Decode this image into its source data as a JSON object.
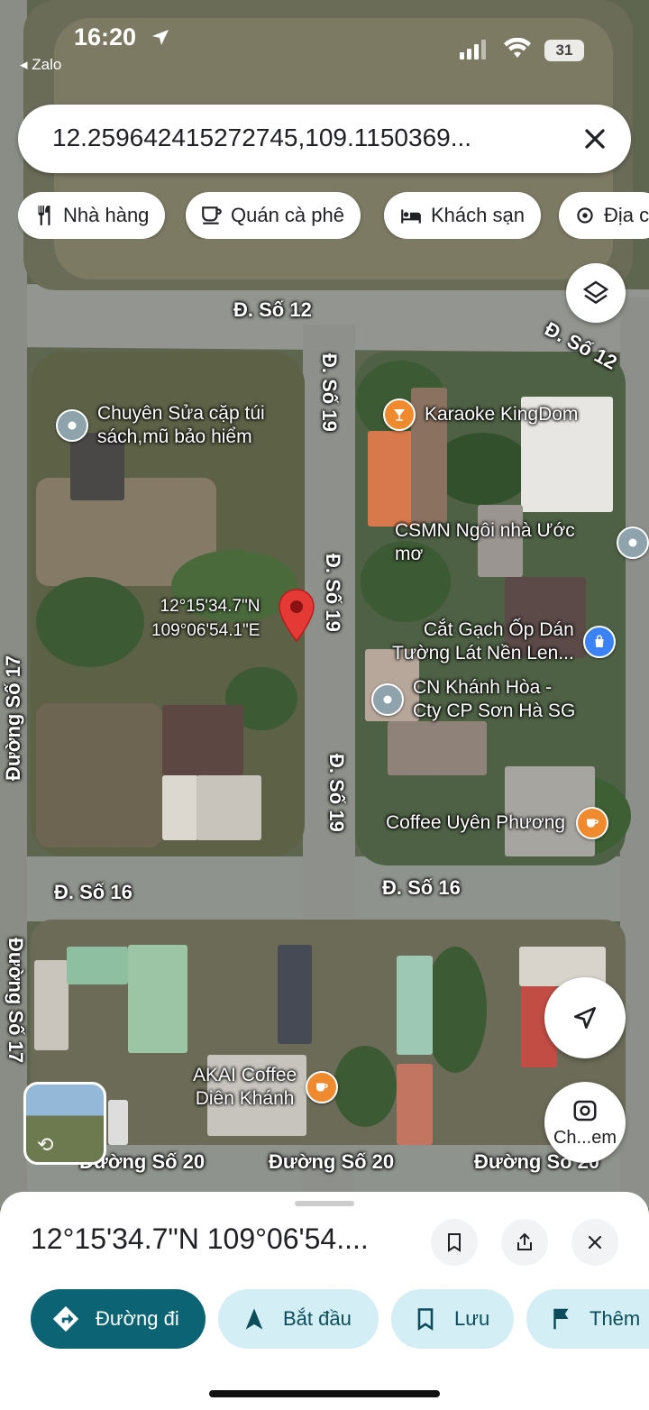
{
  "status_bar": {
    "time": "16:20",
    "back_app": "Zalo",
    "battery": "31"
  },
  "search": {
    "query": "12.259642415272745,109.1150369..."
  },
  "chips": [
    {
      "label": "Nhà hàng",
      "icon": "restaurant-icon"
    },
    {
      "label": "Quán cà phê",
      "icon": "cafe-icon"
    },
    {
      "label": "Khách sạn",
      "icon": "hotel-icon"
    },
    {
      "label": "Địa c",
      "icon": "attraction-icon"
    }
  ],
  "map": {
    "streets": [
      "Đ. Số 12",
      "Đ. Số 12",
      "Đ. Số 19",
      "Đ. Số 19",
      "Đ. Số 19",
      "Đường Số 17",
      "Đường Số 17",
      "Đ. Số 16",
      "Đ. Số 16",
      "Đường Số 20",
      "Đường Số 20",
      "Đường Số 20"
    ],
    "pois": [
      {
        "name": "Chuyên Sửa cặp túi\nsách,mũ bảo hiểm",
        "icon": "location-pin-icon",
        "color": "#8fa3ad"
      },
      {
        "name": "Karaoke KingDom",
        "icon": "cocktail-icon",
        "color": "#f08a2e"
      },
      {
        "name": "CSMN Ngôi nhà Ước mơ",
        "icon": "location-pin-icon",
        "color": "#8fa3ad"
      },
      {
        "name": "Cắt Gạch Ốp Dán\nTường Lát Nền Len...",
        "icon": "shopping-bag-icon",
        "color": "#3b82f6"
      },
      {
        "name": "CN Khánh Hòa -\nCty CP Sơn Hà SG",
        "icon": "location-pin-icon",
        "color": "#8fa3ad"
      },
      {
        "name": "Coffee Uyên Phương",
        "icon": "coffee-icon",
        "color": "#f08a2e"
      },
      {
        "name": "AKAI Coffee\nDiên Khánh",
        "icon": "coffee-icon",
        "color": "#f08a2e"
      }
    ],
    "pin_label": "12°15'34.7\"N\n109°06'54.1\"E",
    "pin_color": "#e53935",
    "streetview_label": "Ch...em"
  },
  "sheet": {
    "coordinates": "12°15'34.7\"N 109°06'54....",
    "actions": [
      {
        "label": "Đường đi",
        "icon": "directions-icon"
      },
      {
        "label": "Bắt đầu",
        "icon": "navigation-arrow-icon"
      },
      {
        "label": "Lưu",
        "icon": "bookmark-icon"
      },
      {
        "label": "Thêm",
        "icon": "flag-icon"
      }
    ]
  }
}
